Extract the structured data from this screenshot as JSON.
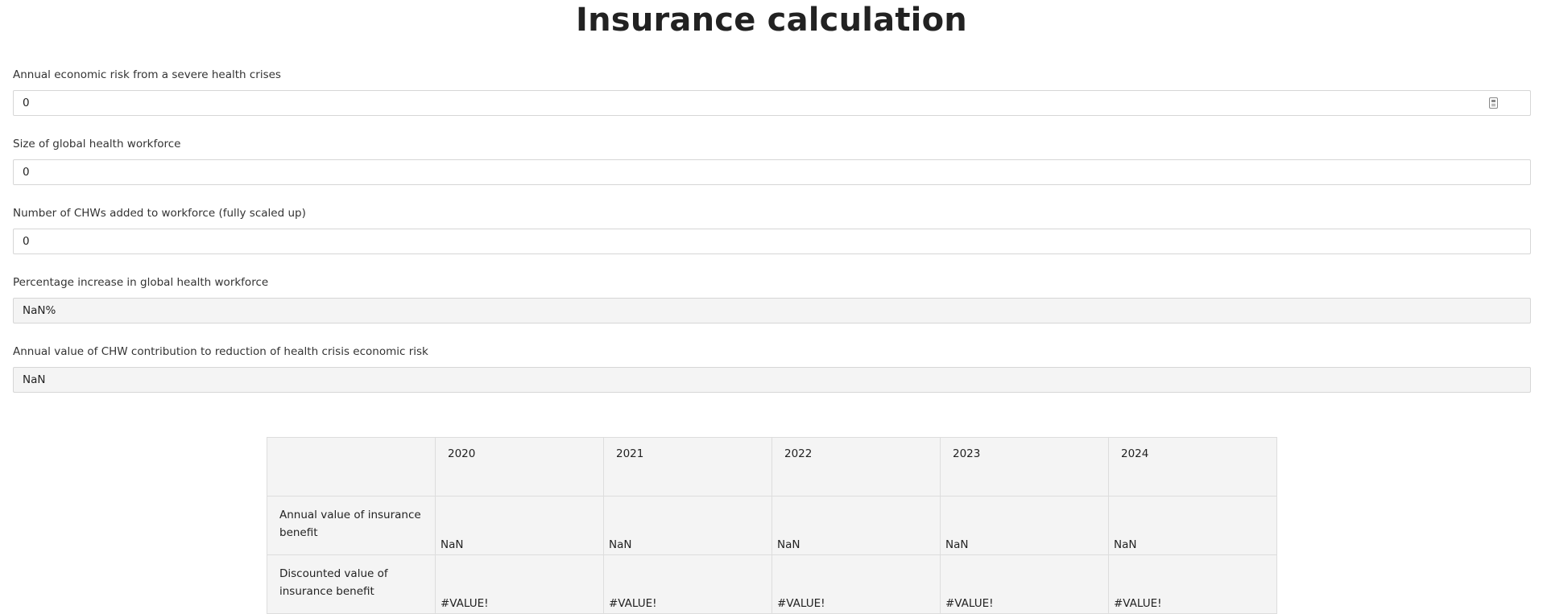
{
  "page": {
    "title": "Insurance calculation"
  },
  "fields": [
    {
      "label": "Annual economic risk from a severe health crises",
      "value": "0",
      "editable": true,
      "icon": "calculator-icon"
    },
    {
      "label": "Size of global health workforce",
      "value": "0",
      "editable": true
    },
    {
      "label": "Number of CHWs added to workforce (fully scaled up)",
      "value": "0",
      "editable": true
    },
    {
      "label": "Percentage increase in global health workforce",
      "value": "NaN%",
      "editable": false
    },
    {
      "label": "Annual value of CHW contribution to reduction of health crisis economic risk",
      "value": "NaN",
      "editable": false
    }
  ],
  "table": {
    "years": [
      "2020",
      "2021",
      "2022",
      "2023",
      "2024"
    ],
    "rows": [
      {
        "label": "Annual value of insurance benefit",
        "values": [
          "NaN",
          "NaN",
          "NaN",
          "NaN",
          "NaN"
        ]
      },
      {
        "label": "Discounted value of insurance benefit",
        "values": [
          "#VALUE!",
          "#VALUE!",
          "#VALUE!",
          "#VALUE!",
          "#VALUE!"
        ]
      }
    ]
  },
  "colors": {
    "field_border": "#d6d6d6",
    "readonly_background": "#f4f4f4",
    "table_background": "#f4f4f4",
    "title_text": "#222222"
  }
}
